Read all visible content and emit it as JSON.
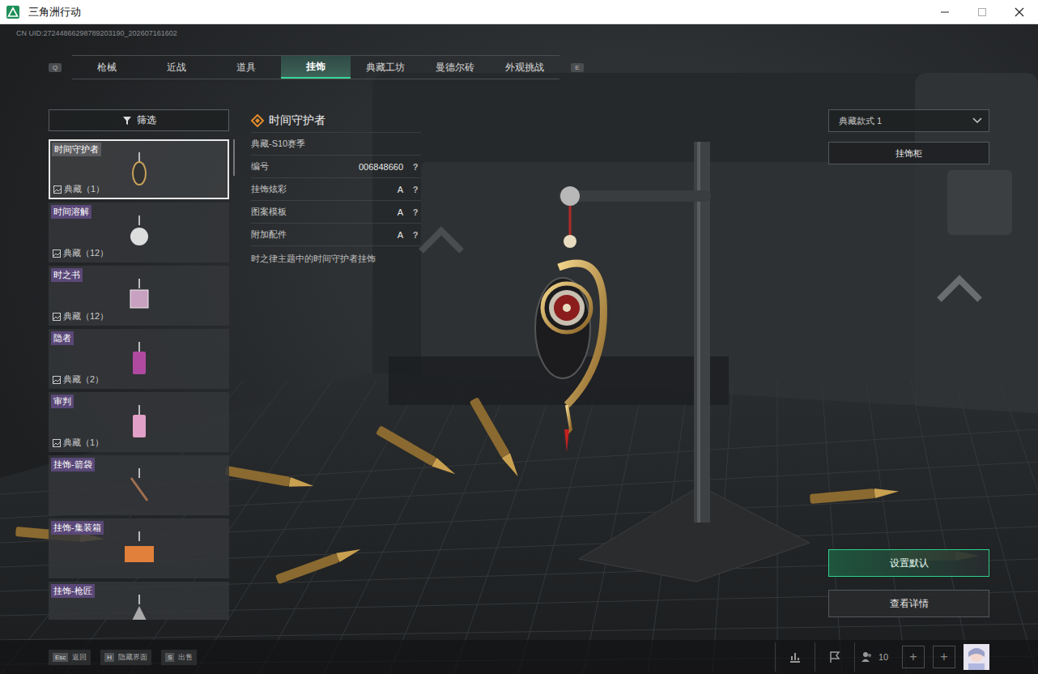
{
  "window": {
    "title": "三角洲行动"
  },
  "uid": "CN UID:27244866298789203190_202607161602",
  "tab_keys": {
    "prev": "Q",
    "next": "E"
  },
  "tabs": [
    {
      "label": "枪械",
      "selected": false
    },
    {
      "label": "近战",
      "selected": false
    },
    {
      "label": "道具",
      "selected": false
    },
    {
      "label": "挂饰",
      "selected": true
    },
    {
      "label": "典藏工坊",
      "selected": false
    },
    {
      "label": "曼德尔砖",
      "selected": false
    },
    {
      "label": "外观挑战",
      "selected": false
    }
  ],
  "filter": {
    "label": "筛选"
  },
  "items": [
    {
      "name": "时间守护者",
      "kind": "collection",
      "collection": "典藏（1）",
      "selected": true
    },
    {
      "name": "时间溶解",
      "kind": "collection",
      "collection": "典藏（12）",
      "selected": false
    },
    {
      "name": "时之书",
      "kind": "collection",
      "collection": "典藏（12）",
      "selected": false
    },
    {
      "name": "隐者",
      "kind": "collection",
      "collection": "典藏（2）",
      "selected": false
    },
    {
      "name": "审判",
      "kind": "collection",
      "collection": "典藏（1）",
      "selected": false
    },
    {
      "name": "挂饰-箭袋",
      "kind": "basic",
      "selected": false
    },
    {
      "name": "挂饰-集装箱",
      "kind": "basic",
      "selected": false
    },
    {
      "name": "挂饰-枪匠",
      "kind": "basic",
      "selected": false
    }
  ],
  "detail": {
    "title": "时间守护者",
    "season": "典藏-S10赛季",
    "fields": [
      {
        "label": "编号",
        "value": "006848660",
        "help": "?"
      },
      {
        "label": "挂饰炫彩",
        "value": "A",
        "help": "?"
      },
      {
        "label": "图案模板",
        "value": "A",
        "help": "?"
      },
      {
        "label": "附加配件",
        "value": "A",
        "help": "?"
      }
    ],
    "description": "时之律主题中的时间守护者挂饰"
  },
  "style_select": {
    "value": "典藏款式 1"
  },
  "cabinet_button": "挂饰柜",
  "actions": [
    {
      "label": "设置默认",
      "highlighted": true
    },
    {
      "label": "查看详情",
      "highlighted": false
    }
  ],
  "footer": {
    "keys": [
      {
        "key": "Esc",
        "label": "返回"
      },
      {
        "key": "H",
        "label": "隐藏界面"
      },
      {
        "key": "S",
        "label": "出售"
      }
    ],
    "friends": "10",
    "add_slots": [
      "+",
      "+"
    ]
  }
}
